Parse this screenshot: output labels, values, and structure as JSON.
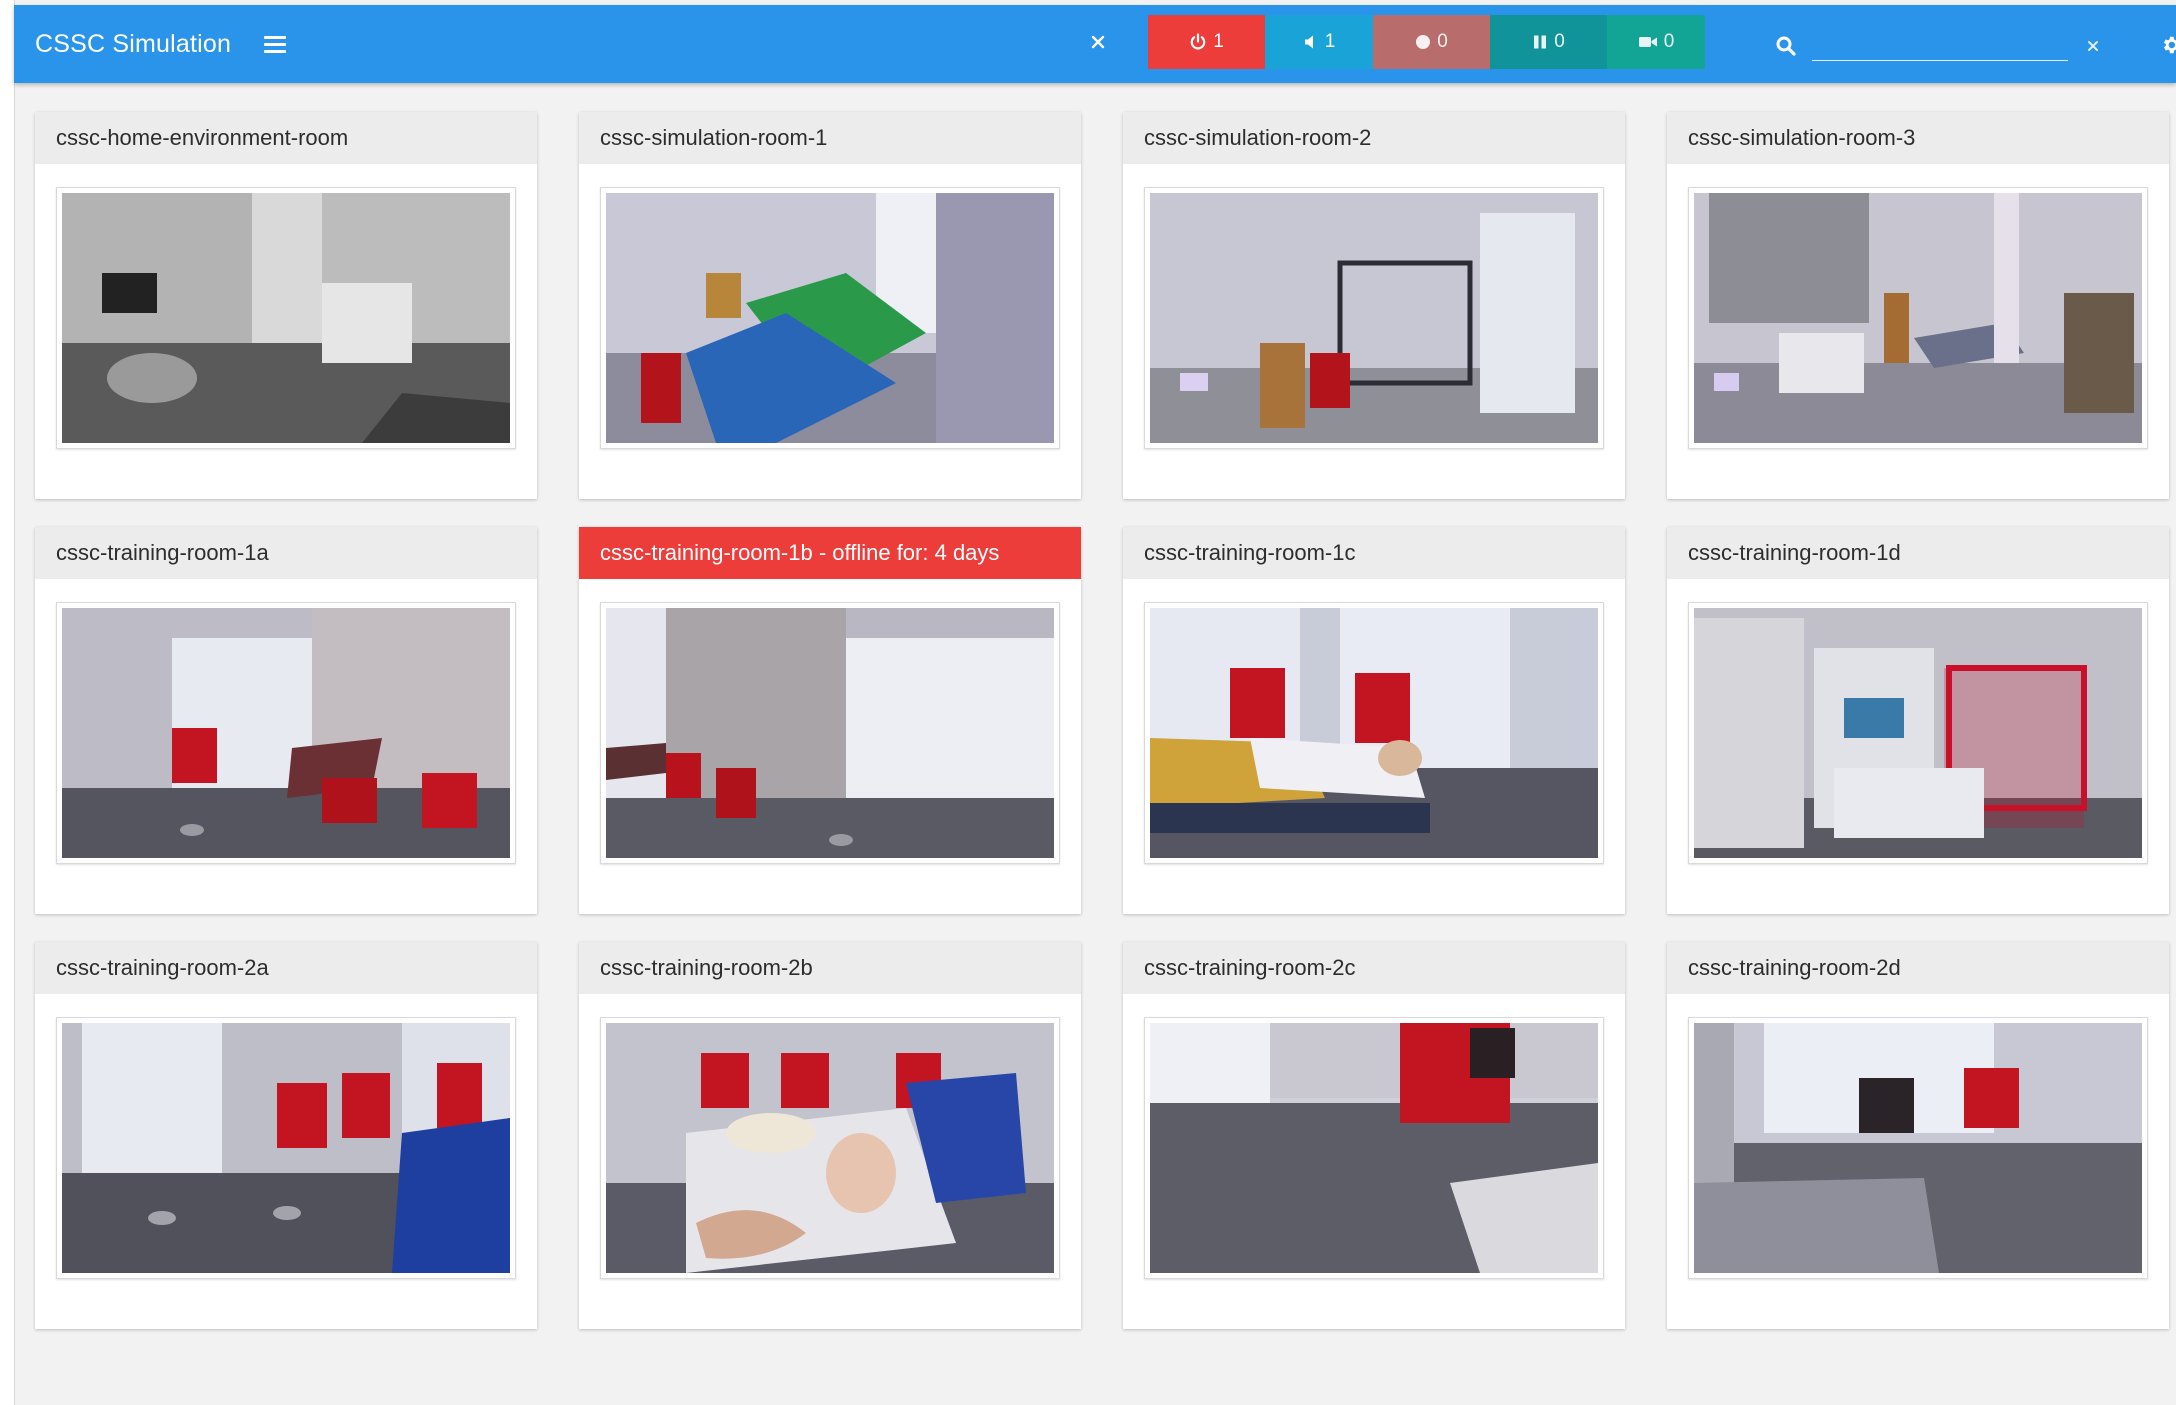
{
  "app": {
    "title": "CSSC Simulation"
  },
  "toolbar": {
    "power_count": "1",
    "sound_count": "1",
    "record_count": "0",
    "pause_count": "0",
    "camera_count": "0"
  },
  "search": {
    "value": "",
    "placeholder": ""
  },
  "colors": {
    "header_blue": "#2a94ea",
    "offline_red": "#ec3d3a",
    "power_red": "#ec3d3a",
    "sound_blue": "#1aa3d6",
    "record_rose": "#b86c6c",
    "pause_teal": "#11939a",
    "camera_teal": "#12a495"
  },
  "rooms": [
    {
      "name": "cssc-home-environment-room",
      "status": "online"
    },
    {
      "name": "cssc-simulation-room-1",
      "status": "online"
    },
    {
      "name": "cssc-simulation-room-2",
      "status": "online"
    },
    {
      "name": "cssc-simulation-room-3",
      "status": "online"
    },
    {
      "name": "cssc-training-room-1a",
      "status": "online"
    },
    {
      "name": "cssc-training-room-1b - offline for: 4 days",
      "status": "offline"
    },
    {
      "name": "cssc-training-room-1c",
      "status": "online"
    },
    {
      "name": "cssc-training-room-1d",
      "status": "online"
    },
    {
      "name": "cssc-training-room-2a",
      "status": "online"
    },
    {
      "name": "cssc-training-room-2b",
      "status": "online"
    },
    {
      "name": "cssc-training-room-2c",
      "status": "online"
    },
    {
      "name": "cssc-training-room-2d",
      "status": "online"
    }
  ]
}
